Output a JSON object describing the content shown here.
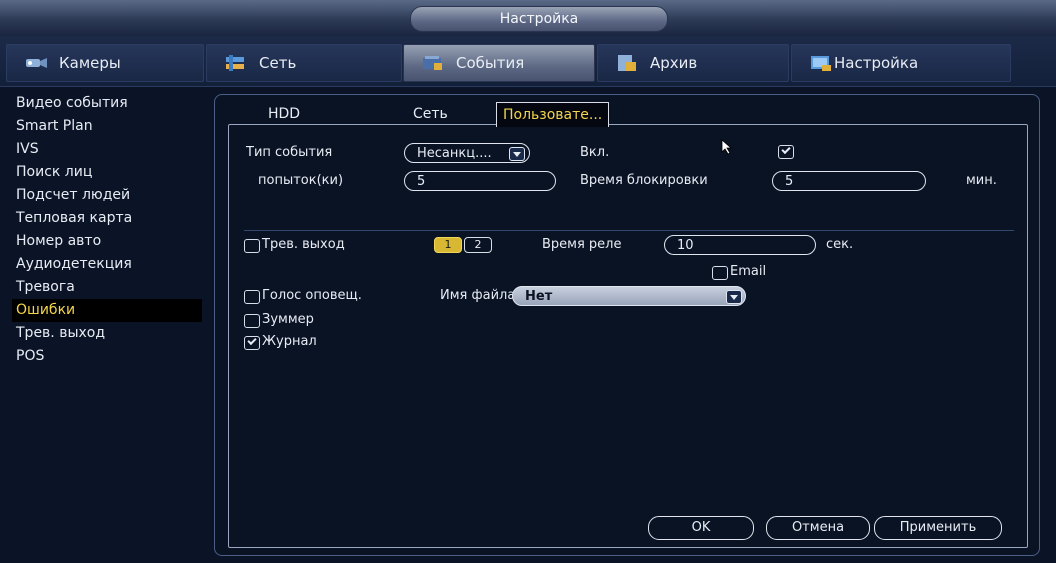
{
  "window": {
    "title": "Настройка"
  },
  "main_tabs": [
    {
      "label": "Камеры",
      "icon": "camera-icon"
    },
    {
      "label": "Сеть",
      "icon": "network-icon"
    },
    {
      "label": "События",
      "icon": "events-icon",
      "active": true
    },
    {
      "label": "Архив",
      "icon": "archive-icon"
    },
    {
      "label": "Настройка",
      "icon": "settings-icon"
    }
  ],
  "sidebar": {
    "items": [
      {
        "label": "Видео события"
      },
      {
        "label": "Smart Plan"
      },
      {
        "label": "IVS"
      },
      {
        "label": "Поиск лиц"
      },
      {
        "label": "Подсчет людей"
      },
      {
        "label": "Тепловая карта"
      },
      {
        "label": "Номер авто"
      },
      {
        "label": "Аудиодетекция"
      },
      {
        "label": "Тревога"
      },
      {
        "label": "Ошибки",
        "active": true
      },
      {
        "label": "Трев. выход"
      },
      {
        "label": "POS"
      }
    ]
  },
  "sub_tabs": [
    {
      "label": "HDD"
    },
    {
      "label": "Сеть"
    },
    {
      "label": "Пользовате...",
      "active": true
    }
  ],
  "form": {
    "event_type_label": "Тип события",
    "event_type_value": "Несанкц....",
    "enable_label": "Вкл.",
    "enable_checked": true,
    "attempts_label": "попыток(ки)",
    "attempts_value": "5",
    "lock_time_label": "Время блокировки",
    "lock_time_value": "5",
    "lock_time_unit": "мин.",
    "alarm_out_label": "Трев. выход",
    "alarm_out_checked": false,
    "alarm_channels": [
      "1",
      "2"
    ],
    "relay_time_label": "Время реле",
    "relay_time_value": "10",
    "relay_time_unit": "сек.",
    "email_label": "Email",
    "email_checked": false,
    "voice_label": "Голос оповещ.",
    "voice_checked": false,
    "file_name_label": "Имя файла",
    "file_name_value": "Нет",
    "buzzer_label": "Зуммер",
    "buzzer_checked": false,
    "log_label": "Журнал",
    "log_checked": true
  },
  "buttons": {
    "ok": "OK",
    "cancel": "Отмена",
    "apply": "Применить"
  },
  "colors": {
    "accent": "#f5d54a",
    "background": "#0b1426"
  }
}
